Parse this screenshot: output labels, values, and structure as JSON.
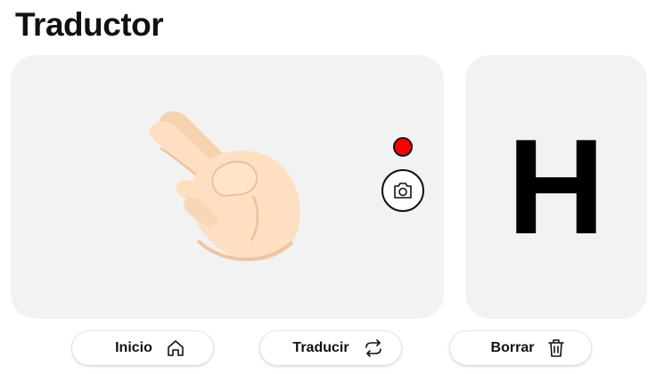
{
  "header": {
    "title": "Traductor"
  },
  "camera": {
    "gesture_icon": "two-finger-hand-icon",
    "record_indicator_color": "#ff0000",
    "capture_icon": "camera-icon"
  },
  "output": {
    "letter": "H"
  },
  "actions": {
    "inicio_label": "Inicio",
    "inicio_icon": "home-icon",
    "traducir_label": "Traducir",
    "traducir_icon": "repeat-icon",
    "borrar_label": "Borrar",
    "borrar_icon": "trash-icon"
  }
}
